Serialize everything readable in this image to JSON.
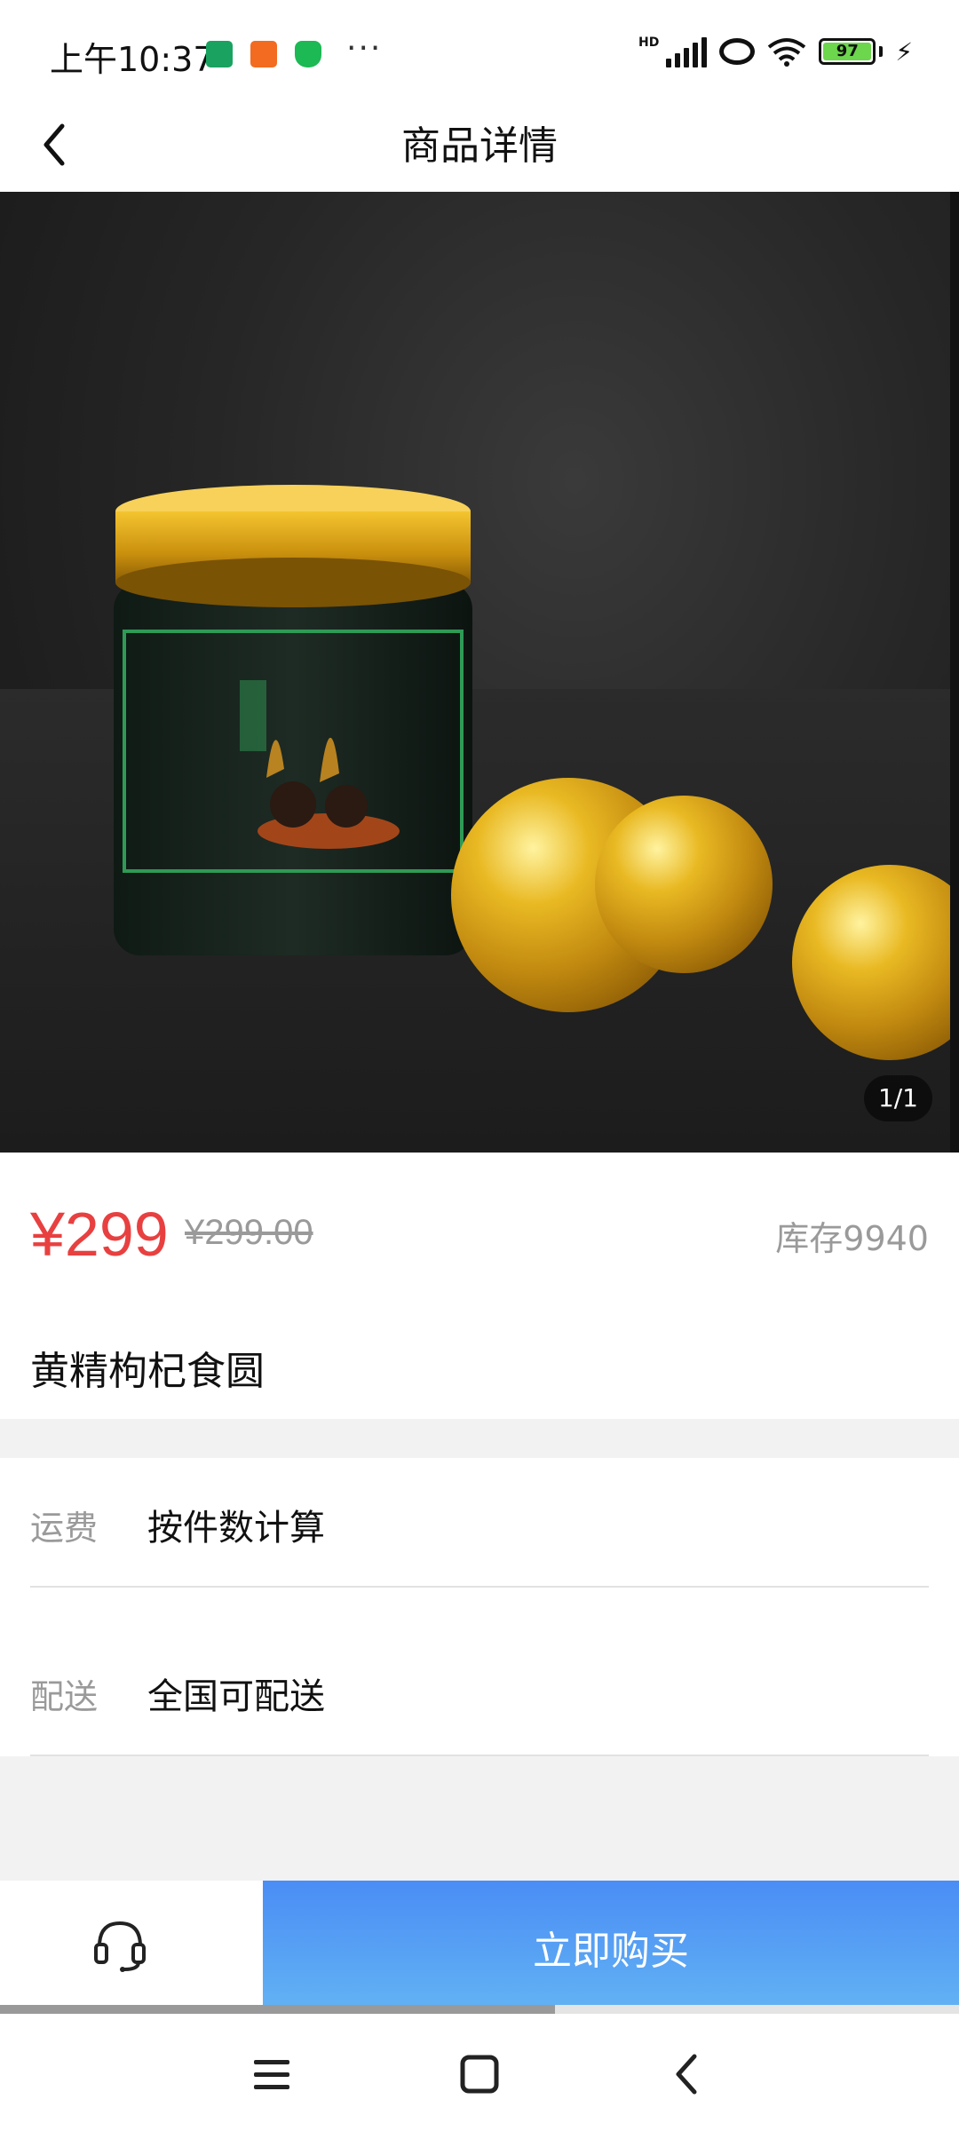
{
  "status_bar": {
    "time": "上午10:37",
    "more": "···",
    "battery": "97",
    "icons": [
      "download-icon",
      "app-notification-icon",
      "shield-icon",
      "signal-icon",
      "link-icon",
      "wifi-icon",
      "battery-icon",
      "charging-icon"
    ]
  },
  "header": {
    "title": "商品详情",
    "back_icon": "chevron-left-icon"
  },
  "gallery": {
    "counter": "1/1"
  },
  "product": {
    "price": "¥299",
    "original_price": "¥299.00",
    "stock": "库存9940",
    "name": "黄精枸杞食圆"
  },
  "info": {
    "rows": [
      {
        "label": "运费",
        "value": "按件数计算"
      },
      {
        "label": "配送",
        "value": "全国可配送"
      }
    ]
  },
  "actions": {
    "service_icon": "headset-icon",
    "buy_label": "立即购买"
  },
  "colors": {
    "price": "#e84040",
    "buy_button": "#4a8df5",
    "muted_text": "#9a9a9a"
  },
  "system_nav": [
    "menu-icon",
    "home-icon",
    "back-icon"
  ]
}
